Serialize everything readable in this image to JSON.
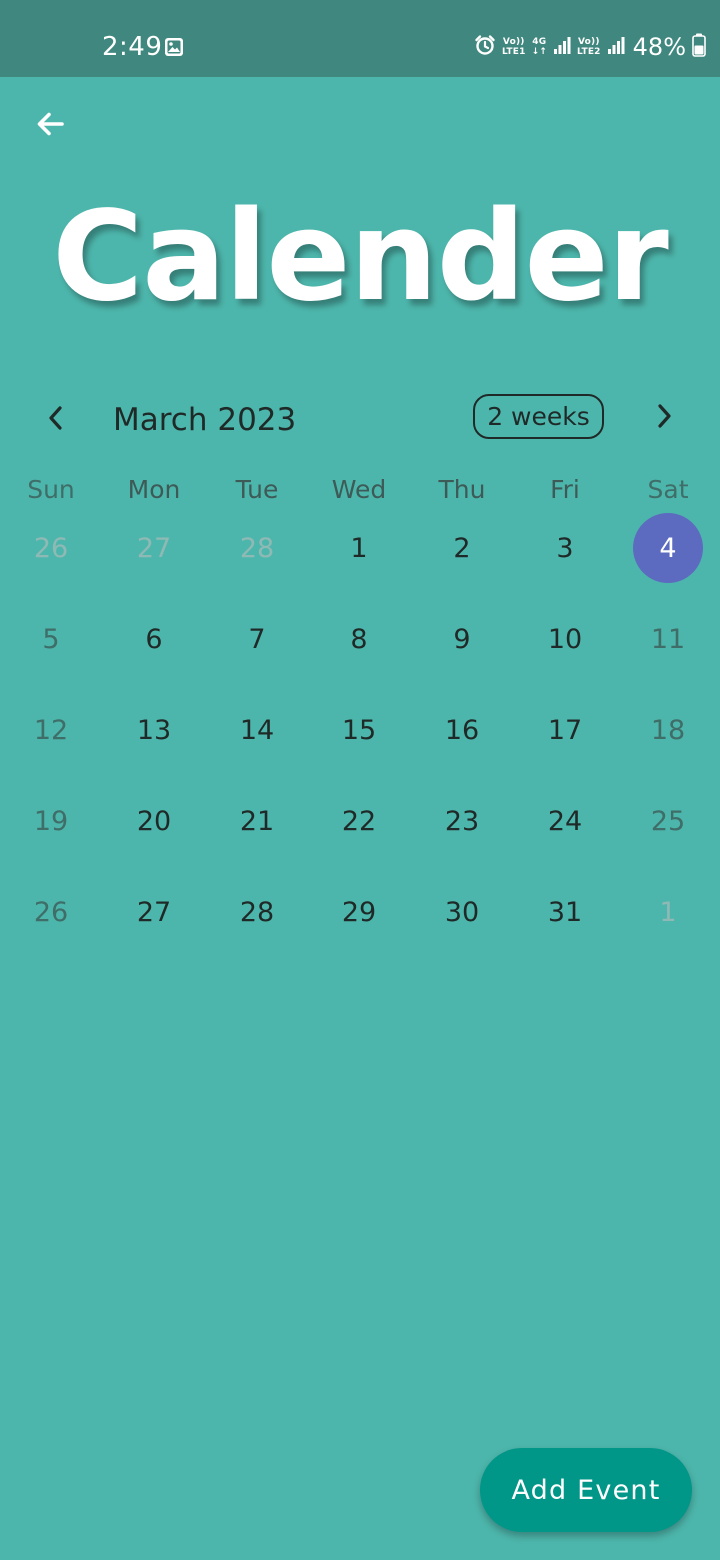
{
  "status_bar": {
    "time": "2:49",
    "net1_top": "Vo))",
    "net1_bottom": "LTE1",
    "net_type_top": "4G",
    "net_type_bottom": "↓↑",
    "net2_top": "Vo))",
    "net2_bottom": "LTE2",
    "battery": "48%"
  },
  "app": {
    "title": "Calender",
    "add_event_label": "Add Event"
  },
  "calendar": {
    "month_title": "March 2023",
    "format_label": "2 weeks",
    "weekdays": [
      "Sun",
      "Mon",
      "Tue",
      "Wed",
      "Thu",
      "Fri",
      "Sat"
    ],
    "weeks": [
      [
        "26",
        "27",
        "28",
        "1",
        "2",
        "3",
        "4"
      ],
      [
        "5",
        "6",
        "7",
        "8",
        "9",
        "10",
        "11"
      ],
      [
        "12",
        "13",
        "14",
        "15",
        "16",
        "17",
        "18"
      ],
      [
        "19",
        "20",
        "21",
        "22",
        "23",
        "24",
        "25"
      ],
      [
        "26",
        "27",
        "28",
        "29",
        "30",
        "31",
        "1"
      ]
    ],
    "selected_day": "4",
    "selected_color": "#5c6bc0"
  },
  "colors": {
    "background": "#4db6ac",
    "status_bar": "#40877f",
    "fab": "#009688"
  },
  "icons": {
    "back": "arrow-left-icon",
    "prev": "chevron-left-icon",
    "next": "chevron-right-icon"
  }
}
